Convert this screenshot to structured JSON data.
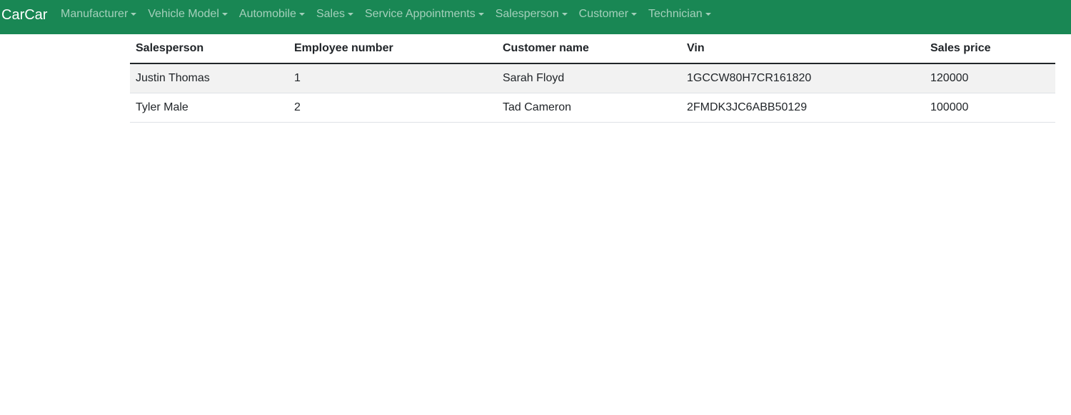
{
  "navbar": {
    "brand": "CarCar",
    "items": [
      {
        "label": "Manufacturer"
      },
      {
        "label": "Vehicle Model"
      },
      {
        "label": "Automobile"
      },
      {
        "label": "Sales"
      },
      {
        "label": "Service Appointments"
      },
      {
        "label": "Salesperson"
      },
      {
        "label": "Customer"
      },
      {
        "label": "Technician"
      }
    ]
  },
  "colors": {
    "navbar_bg": "#198754",
    "stripe": "#f2f2f2"
  },
  "table": {
    "headers": [
      "Salesperson",
      "Employee number",
      "Customer name",
      "Vin",
      "Sales price"
    ],
    "rows": [
      [
        "Justin Thomas",
        "1",
        "Sarah Floyd",
        "1GCCW80H7CR161820",
        "120000"
      ],
      [
        "Tyler Male",
        "2",
        "Tad Cameron",
        "2FMDK3JC6ABB50129",
        "100000"
      ]
    ]
  }
}
